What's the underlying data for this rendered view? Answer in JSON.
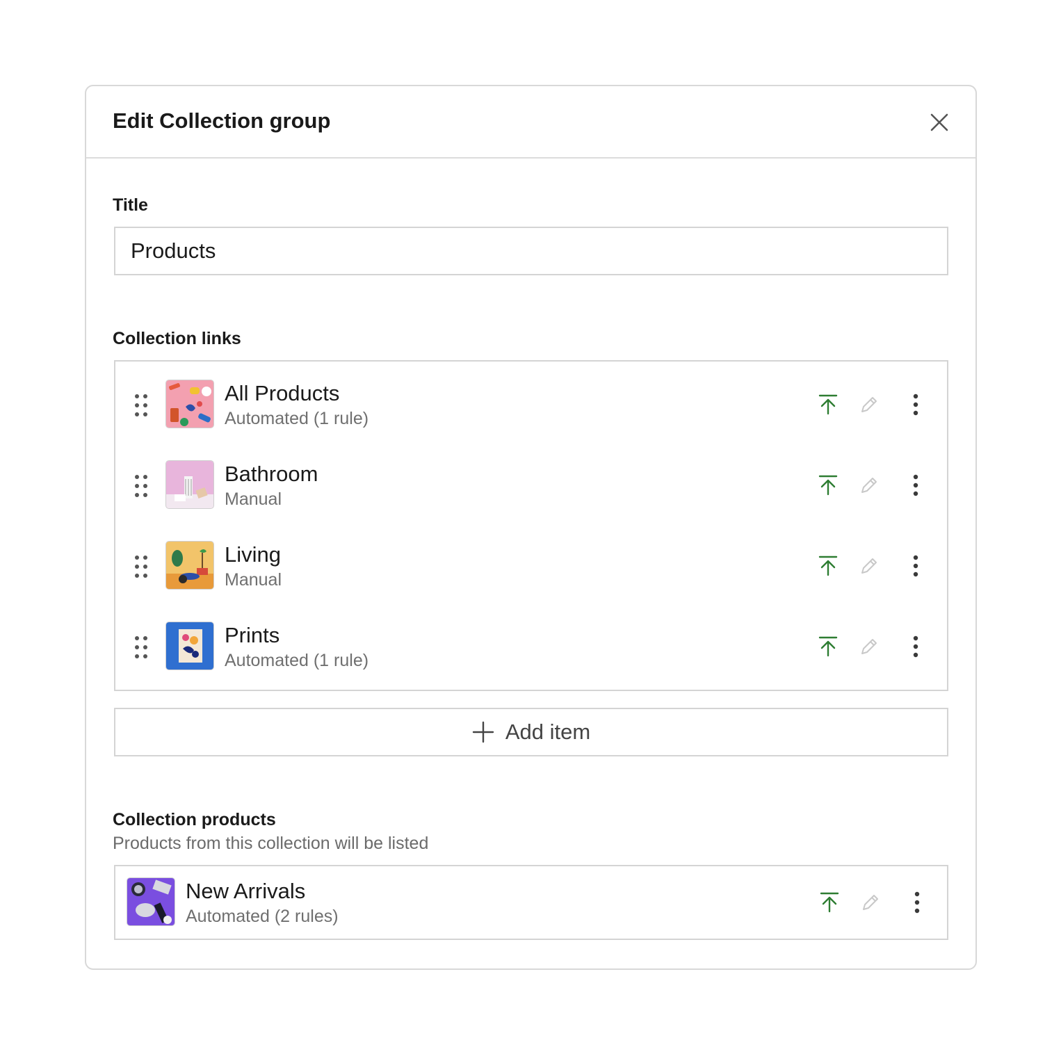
{
  "dialog": {
    "title": "Edit Collection group",
    "close_icon": "close-icon"
  },
  "title_field": {
    "label": "Title",
    "value": "Products"
  },
  "collection_links": {
    "label": "Collection links",
    "items": [
      {
        "name": "All Products",
        "meta": "Automated (1 rule)",
        "thumb": "all-products-thumbnail"
      },
      {
        "name": "Bathroom",
        "meta": "Manual",
        "thumb": "bathroom-thumbnail"
      },
      {
        "name": "Living",
        "meta": "Manual",
        "thumb": "living-thumbnail"
      },
      {
        "name": "Prints",
        "meta": "Automated (1 rule)",
        "thumb": "prints-thumbnail"
      }
    ],
    "add_label": "Add item"
  },
  "collection_products": {
    "label": "Collection products",
    "help": "Products from this collection will be listed",
    "item": {
      "name": "New Arrivals",
      "meta": "Automated (2 rules)",
      "thumb": "new-arrivals-thumbnail"
    }
  },
  "icons": {
    "drag": "drag-handle-icon",
    "move_top": "move-to-top-icon",
    "edit": "pencil-icon",
    "more": "more-vertical-icon",
    "add": "plus-icon"
  },
  "colors": {
    "accent_green": "#2e7d32",
    "muted_icon": "#c8c8c8",
    "border": "#d4d4d4"
  }
}
